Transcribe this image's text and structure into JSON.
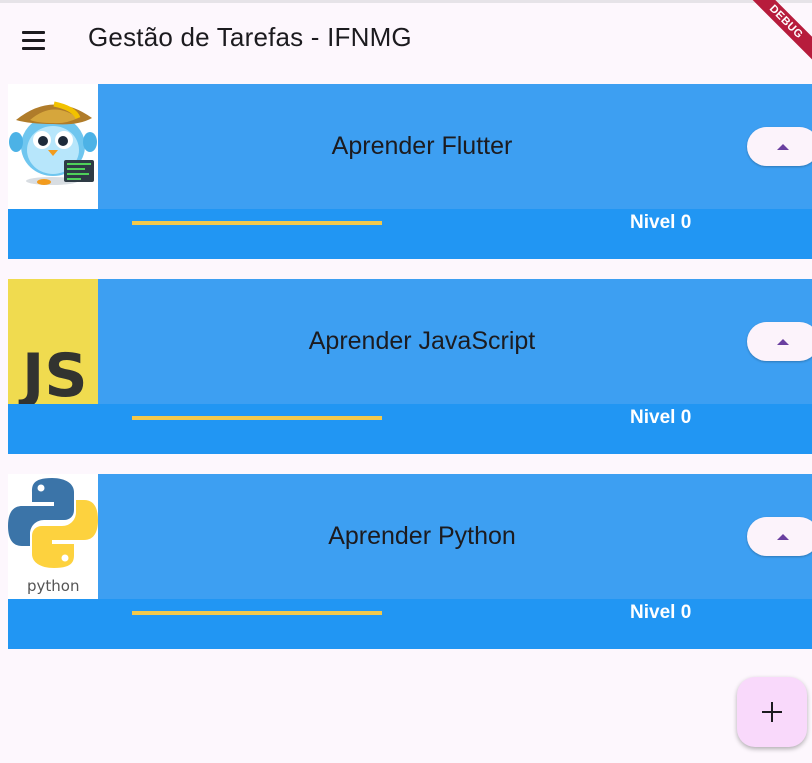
{
  "app_bar": {
    "title": "Gestão de Tarefas - IFNMG",
    "menu_icon": "menu-icon",
    "debug_banner": "DEBUG"
  },
  "colors": {
    "background": "#fdf7fd",
    "card_top": "#3d9ff2",
    "card_bottom": "#2196f3",
    "progress": "#f0b900",
    "fab": "#f9d9fb",
    "debug": "#b71c3c"
  },
  "tasks": [
    {
      "title": "Aprender Flutter",
      "level_label": "Nivel 0",
      "progress": 0,
      "image": "flutter-dash-mascot",
      "up_icon": "arrow-up-icon"
    },
    {
      "title": "Aprender JavaScript",
      "level_label": "Nivel 0",
      "progress": 0,
      "image": "javascript-logo",
      "up_icon": "arrow-up-icon"
    },
    {
      "title": "Aprender Python",
      "level_label": "Nivel 0",
      "progress": 0,
      "image": "python-logo",
      "up_icon": "arrow-up-icon"
    }
  ],
  "js_logo_text": "JS",
  "python_logo_text": "python",
  "fab": {
    "icon": "plus-icon"
  }
}
